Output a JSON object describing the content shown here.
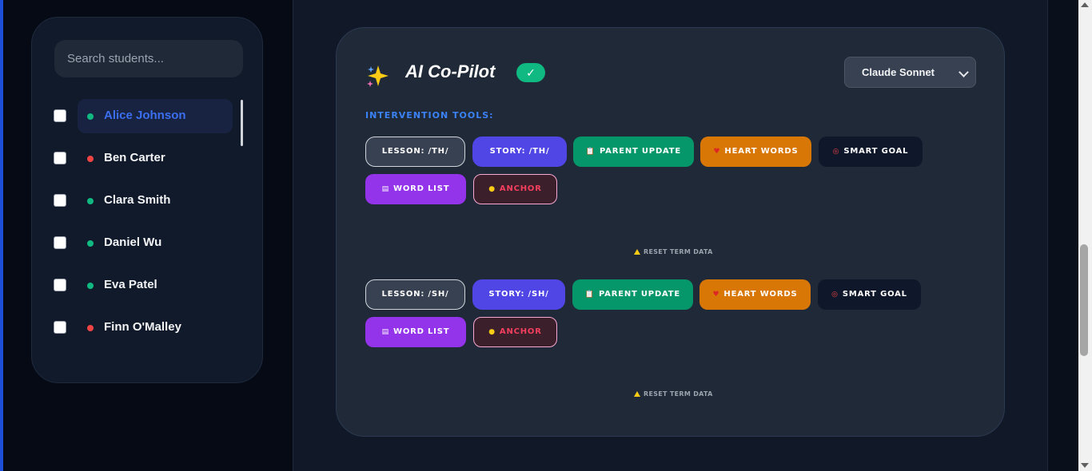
{
  "sidebar": {
    "search_placeholder": "Search students...",
    "students": [
      {
        "name": "Alice Johnson",
        "status": "green",
        "active": true
      },
      {
        "name": "Ben Carter",
        "status": "red",
        "active": false
      },
      {
        "name": "Clara Smith",
        "status": "green",
        "active": false
      },
      {
        "name": "Daniel Wu",
        "status": "green",
        "active": false
      },
      {
        "name": "Eva Patel",
        "status": "green",
        "active": false
      },
      {
        "name": "Finn O'Malley",
        "status": "red",
        "active": false
      }
    ]
  },
  "copilot": {
    "title": "AI Co-Pilot",
    "status_check": "✓",
    "model_selected": "Claude Sonnet",
    "section_label": "INTERVENTION TOOLS:",
    "groups": [
      {
        "lesson": "LESSON: /TH/",
        "story": "STORY: /TH/",
        "parent_update": "PARENT UPDATE",
        "heart_words": "HEART WORDS",
        "smart_goal": "SMART GOAL",
        "word_list": "WORD LIST",
        "anchor": "ANCHOR",
        "reset": "RESET TERM DATA"
      },
      {
        "lesson": "LESSON: /SH/",
        "story": "STORY: /SH/",
        "parent_update": "PARENT UPDATE",
        "heart_words": "HEART WORDS",
        "smart_goal": "SMART GOAL",
        "word_list": "WORD LIST",
        "anchor": "ANCHOR",
        "reset": "RESET TERM DATA"
      }
    ]
  },
  "icons": {
    "parent_update": "clipboard-icon",
    "heart_words": "heart-icon",
    "smart_goal": "target-icon",
    "word_list": "notepad-icon",
    "anchor": "brain-icon",
    "reset": "warning-icon",
    "title": "sparkles-icon"
  },
  "colors": {
    "accent": "#3b82f6",
    "active_text": "#3b6ff0",
    "status_green": "#10b981",
    "status_red": "#ef4444",
    "story": "#4f46e5",
    "parent_update": "#059669",
    "heart_words": "#d97706",
    "word_list": "#9333ea",
    "anchor_text": "#f43f5e"
  }
}
